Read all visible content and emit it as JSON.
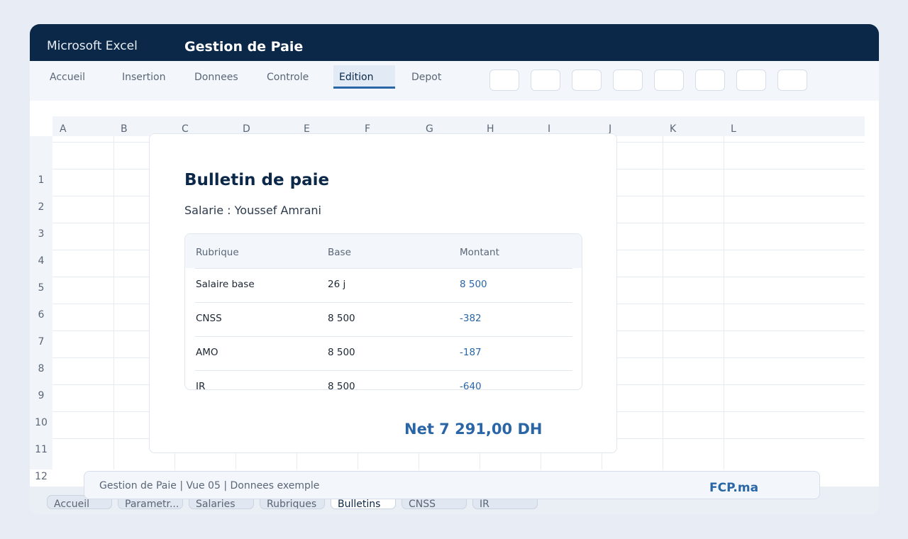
{
  "window": {
    "app_name": "Microsoft Excel",
    "title": "Gestion de Paie"
  },
  "ribbon": {
    "tabs": [
      "Accueil",
      "Insertion",
      "Donnees",
      "Controle",
      "Edition",
      "Depot"
    ],
    "active_tab": "Edition",
    "button_count": 8
  },
  "sheet": {
    "columns": [
      "A",
      "B",
      "C",
      "D",
      "E",
      "F",
      "G",
      "H",
      "I",
      "J",
      "K",
      "L"
    ],
    "rows": [
      "1",
      "2",
      "3",
      "4",
      "5",
      "6",
      "7",
      "8",
      "9",
      "10",
      "11",
      "12"
    ]
  },
  "payslip": {
    "title": "Bulletin de paie",
    "employee": "Salarie : Youssef Amrani",
    "headers": [
      "Rubrique",
      "Base",
      "Montant"
    ],
    "rows": [
      {
        "rubrique": "Salaire base",
        "base": "26 j",
        "montant": "8 500"
      },
      {
        "rubrique": "CNSS",
        "base": "8 500",
        "montant": "-382"
      },
      {
        "rubrique": "AMO",
        "base": "8 500",
        "montant": "-187"
      },
      {
        "rubrique": "IR",
        "base": "8 500",
        "montant": "-640"
      }
    ],
    "net": "Net 7 291,00 DH"
  },
  "status": {
    "text": "Gestion de Paie | Vue 05 | Donnees exemple",
    "brand": "FCP.ma"
  },
  "sheet_tabs": [
    "Accueil",
    "Parametr...",
    "Salaries",
    "Rubriques",
    "Bulletins",
    "CNSS",
    "IR"
  ],
  "active_sheet_tab": "Bulletins",
  "colors": {
    "titlebar": "#0b2848",
    "accent": "#2a66a6"
  }
}
